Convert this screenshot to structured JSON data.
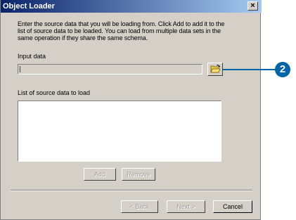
{
  "window": {
    "title": "Object Loader",
    "close_glyph": "×"
  },
  "instructions": "Enter the source data that you will be loading from. Click Add to add it to the list of source data to be loaded. You can load from multiple data sets in the same operation if they share the same schema.",
  "input": {
    "label": "Input data",
    "value": "",
    "browse_icon": "open-folder-icon"
  },
  "list": {
    "label": "List of source data to load",
    "items": []
  },
  "buttons": {
    "add": "Add",
    "remove": "Remove",
    "back": "< Back",
    "next": "Next >",
    "cancel": "Cancel"
  },
  "callout": {
    "number": "2",
    "color": "#0064a8"
  }
}
